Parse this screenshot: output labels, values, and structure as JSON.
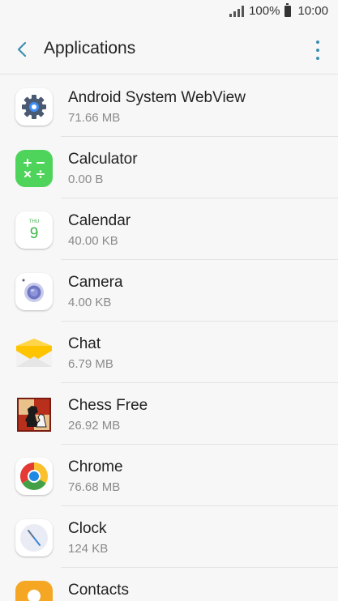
{
  "status": {
    "battery_text": "100%",
    "time": "10:00"
  },
  "header": {
    "title": "Applications"
  },
  "apps": [
    {
      "name": "Android System WebView",
      "size": "71.66 MB",
      "icon": "webview-gear-icon"
    },
    {
      "name": "Calculator",
      "size": "0.00 B",
      "icon": "calculator-icon"
    },
    {
      "name": "Calendar",
      "size": "40.00 KB",
      "icon": "calendar-icon",
      "icon_day": "THU",
      "icon_date": "9"
    },
    {
      "name": "Camera",
      "size": "4.00 KB",
      "icon": "camera-icon"
    },
    {
      "name": "Chat",
      "size": "6.79 MB",
      "icon": "chat-envelope-icon"
    },
    {
      "name": "Chess Free",
      "size": "26.92 MB",
      "icon": "chess-icon"
    },
    {
      "name": "Chrome",
      "size": "76.68 MB",
      "icon": "chrome-icon"
    },
    {
      "name": "Clock",
      "size": "124 KB",
      "icon": "clock-icon"
    },
    {
      "name": "Contacts",
      "size": "",
      "icon": "contacts-icon"
    }
  ],
  "colors": {
    "accent": "#3d8fb0",
    "calculator_green": "#4ed45a",
    "contacts_orange": "#f5a623",
    "chat_yellow": "#ffc400"
  }
}
